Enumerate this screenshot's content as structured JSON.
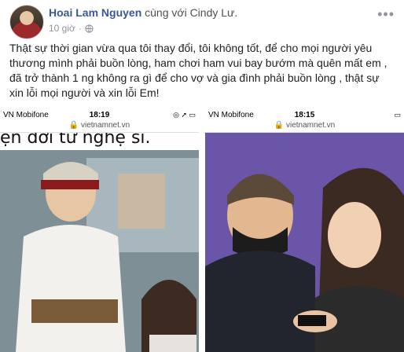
{
  "post": {
    "author": "Hoai Lam Nguyen",
    "with_text": "cùng với Cindy Lư.",
    "time": "10 giờ",
    "privacy_icon": "globe-icon",
    "more_icon": "more-options-icon",
    "text": "Thật sự thời gian vừa qua tôi thay đổi, tôi không tốt, để cho mọi người yêu thương mình phải buồn lòng, ham chơi ham vui bay bướm mà quên mất em , đã trở thành 1 ng không ra gì để cho vợ và gia đình phải buồn lòng , thật sự xin lỗi mọi người và xin lỗi Em!"
  },
  "photos": [
    {
      "carrier": "VN Mobifone",
      "time": "18:19",
      "url": "vietnamnet.vn",
      "caption": "ện đời từ nghệ sĩ."
    },
    {
      "carrier": "VN Mobifone",
      "time": "18:15",
      "url": "vietnamnet.vn",
      "caption": ""
    }
  ]
}
